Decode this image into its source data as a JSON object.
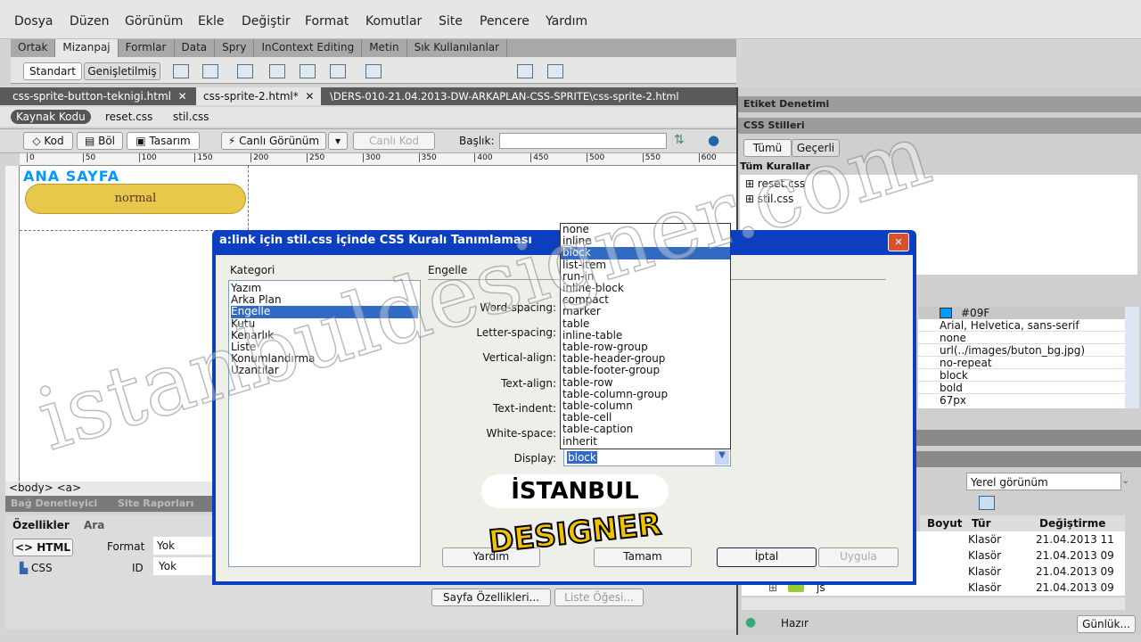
{
  "menu": [
    "Dosya",
    "Düzen",
    "Görünüm",
    "Ekle",
    "Değiştir",
    "Format",
    "Komutlar",
    "Site",
    "Pencere",
    "Yardım"
  ],
  "insert_tabs": [
    "Ortak",
    "Mizanpaj",
    "Formlar",
    "Data",
    "Spry",
    "InContext Editing",
    "Metin",
    "Sık Kullanılanlar"
  ],
  "insert_toolbar": {
    "standart": "Standart",
    "genisletilmis": "Genişletilmiş"
  },
  "doc_tabs": [
    {
      "label": "css-sprite-button-teknigi.html"
    },
    {
      "label": "css-sprite-2.html*"
    }
  ],
  "doc_path": "\\DERS-010-21.04.2013-DW-ARKAPLAN-CSS-SPRITE\\css-sprite-2.html",
  "related_files": [
    "Kaynak Kodu",
    "reset.css",
    "stil.css"
  ],
  "doc_toolbar": {
    "kod": "Kod",
    "bol": "Böl",
    "tasarim": "Tasarım",
    "canli": "Canlı Görünüm",
    "canli_kod": "Canlı Kod",
    "baslik_label": "Başlık:",
    "baslik_value": ""
  },
  "ruler_ticks": [
    "0",
    "50",
    "100",
    "150",
    "200",
    "250",
    "300",
    "350",
    "400",
    "450",
    "500",
    "550",
    "600"
  ],
  "design": {
    "heading": "ANA SAYFA",
    "button_text": "normal",
    "heading_color": "#0099ff",
    "button_color": "#e8c84a"
  },
  "tag_selector": "<body> <a>",
  "bottom_tabs": [
    "Bağ Denetleyici",
    "Site Raporları"
  ],
  "properties": {
    "tabs": [
      "Özellikler",
      "Ara"
    ],
    "html": "HTML",
    "css": "CSS",
    "format_label": "Format",
    "format_value": "Yok",
    "id_label": "ID",
    "id_value": "Yok",
    "page_props": "Sayfa Özellikleri...",
    "list_item": "Liste Öğesi..."
  },
  "right_panel": {
    "etiket": "Etiket Denetimi",
    "css_stilleri": "CSS Stilleri",
    "tumu": "Tümü",
    "gecerli": "Geçerli",
    "tum_kurallar": "Tüm Kurallar",
    "rules": [
      "reset.css",
      "stil.css"
    ],
    "property_values": [
      "#09F",
      "Arial, Helvetica, sans-serif",
      "none",
      "url(../images/buton_bg.jpg)",
      "no-repeat",
      "block",
      "bold",
      "67px"
    ],
    "swatch_color": "#0099ff",
    "view_select": "Yerel görünüm",
    "file_columns": [
      "Boyut",
      "Tür",
      "Değiştirme"
    ],
    "files": [
      {
        "name": "",
        "type": "Klasör",
        "date": "21.04.2013 11"
      },
      {
        "name": "",
        "type": "Klasör",
        "date": "21.04.2013 09"
      },
      {
        "name": "",
        "type": "Klasör",
        "date": "21.04.2013 09"
      },
      {
        "name": "js",
        "type": "Klasör",
        "date": "21.04.2013 09"
      }
    ],
    "status": "Hazır",
    "log_button": "Günlük..."
  },
  "dialog": {
    "title": "a:link için stil.css içinde CSS Kuralı Tanımlaması",
    "category_label": "Kategori",
    "categories": [
      "Yazım",
      "Arka Plan",
      "Engelle",
      "Kutu",
      "Kenarlık",
      "Liste",
      "Konumlandırma",
      "Uzantılar"
    ],
    "selected_category": "Engelle",
    "section_title": "Engelle",
    "fields": [
      "Word-spacing:",
      "Letter-spacing:",
      "Vertical-align:",
      "Text-align:",
      "Text-indent:",
      "White-space:",
      "Display:"
    ],
    "display_value": "block",
    "buttons": {
      "help": "Yardım",
      "ok": "Tamam",
      "cancel": "İptal",
      "apply": "Uygula"
    }
  },
  "display_options": [
    "none",
    "inline",
    "block",
    "list-item",
    "run-in",
    "inline-block",
    "compact",
    "marker",
    "table",
    "inline-table",
    "table-row-group",
    "table-header-group",
    "table-footer-group",
    "table-row",
    "table-column-group",
    "table-column",
    "table-cell",
    "table-caption",
    "inherit"
  ],
  "display_selected": "block",
  "watermark": "istanbuldesigner.com",
  "logo": {
    "top": "İSTANBUL",
    "bottom": "DESIGNER"
  }
}
